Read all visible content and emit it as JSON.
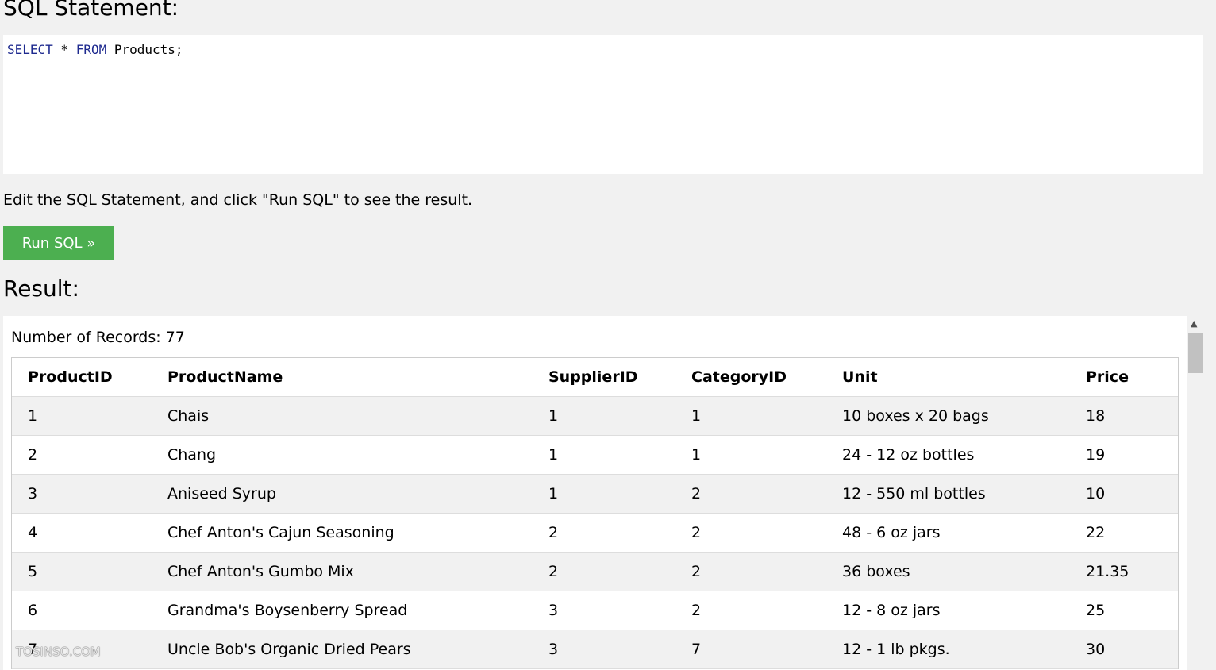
{
  "headings": {
    "sql": "SQL Statement:",
    "result": "Result:"
  },
  "editor": {
    "kw_select": "SELECT",
    "star": " * ",
    "kw_from": "FROM",
    "rest": " Products;"
  },
  "instructions": "Edit the SQL Statement, and click \"Run SQL\" to see the result.",
  "run_button": "Run SQL »",
  "records_label": "Number of Records: 77",
  "table": {
    "headers": [
      "ProductID",
      "ProductName",
      "SupplierID",
      "CategoryID",
      "Unit",
      "Price"
    ],
    "rows": [
      [
        "1",
        "Chais",
        "1",
        "1",
        "10 boxes x 20 bags",
        "18"
      ],
      [
        "2",
        "Chang",
        "1",
        "1",
        "24 - 12 oz bottles",
        "19"
      ],
      [
        "3",
        "Aniseed Syrup",
        "1",
        "2",
        "12 - 550 ml bottles",
        "10"
      ],
      [
        "4",
        "Chef Anton's Cajun Seasoning",
        "2",
        "2",
        "48 - 6 oz jars",
        "22"
      ],
      [
        "5",
        "Chef Anton's Gumbo Mix",
        "2",
        "2",
        "36 boxes",
        "21.35"
      ],
      [
        "6",
        "Grandma's Boysenberry Spread",
        "3",
        "2",
        "12 - 8 oz jars",
        "25"
      ],
      [
        "7",
        "Uncle Bob's Organic Dried Pears",
        "3",
        "7",
        "12 - 1 lb pkgs.",
        "30"
      ]
    ]
  },
  "scrollbar_up_icon": "chevron-up-icon",
  "watermark": "TOSINSO.COM"
}
